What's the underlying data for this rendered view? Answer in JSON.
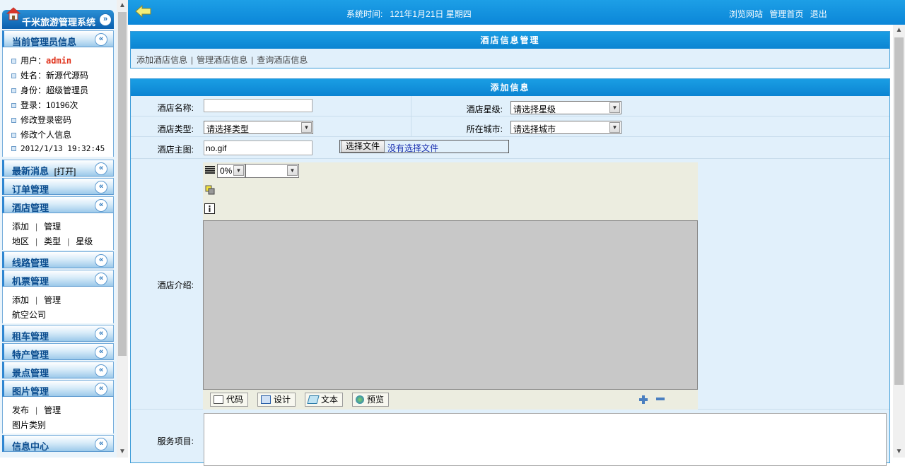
{
  "sidebar": {
    "app_title": "千米旅游管理系统",
    "admin_section": {
      "title": "当前管理员信息",
      "user_label": "用户：",
      "user_value": "admin",
      "name": "姓名：新源代源码",
      "role": "身份：超级管理员",
      "logins": "登录：10196次",
      "change_password": "修改登录密码",
      "change_info": "修改个人信息",
      "last_time": "2012/1/13 19:32:45"
    },
    "news": {
      "title": "最新消息",
      "toggle": "[打开]"
    },
    "orders": {
      "title": "订单管理"
    },
    "hotel": {
      "title": "酒店管理",
      "links1": [
        "添加",
        "管理"
      ],
      "links2": [
        "地区",
        "类型",
        "星级"
      ]
    },
    "routes": {
      "title": "线路管理"
    },
    "tickets": {
      "title": "机票管理",
      "links1": [
        "添加",
        "管理"
      ],
      "links2": [
        "航空公司"
      ]
    },
    "car": {
      "title": "租车管理"
    },
    "specialty": {
      "title": "特产管理"
    },
    "scenic": {
      "title": "景点管理"
    },
    "images": {
      "title": "图片管理",
      "links1": [
        "发布",
        "管理"
      ],
      "links2": [
        "图片类别"
      ]
    },
    "info_center": {
      "title": "信息中心"
    }
  },
  "topbar": {
    "time_label": "系统时间:",
    "time_value": "121年1月21日 星期四",
    "browse_site": "浏览网站",
    "admin_home": "管理首页",
    "logout": "退出"
  },
  "hotel_panel": {
    "title": "酒店信息管理",
    "links": [
      "添加酒店信息",
      "管理酒店信息",
      "查询酒店信息"
    ]
  },
  "form": {
    "title": "添加信息",
    "hotel_name_label": "酒店名称:",
    "hotel_name_value": "",
    "star_label": "酒店星级:",
    "star_value": "请选择星级",
    "type_label": "酒店类型:",
    "type_value": "请选择类型",
    "city_label": "所在城市:",
    "city_value": "请选择城市",
    "image_label": "酒店主图:",
    "image_value": "no.gif",
    "file_button": "选择文件",
    "file_status": "没有选择文件",
    "intro_label": "酒店介绍:",
    "services_label": "服务项目:",
    "editor": {
      "zoom_value": "0%",
      "tabs": [
        "代码",
        "设计",
        "文本",
        "预览"
      ]
    }
  }
}
